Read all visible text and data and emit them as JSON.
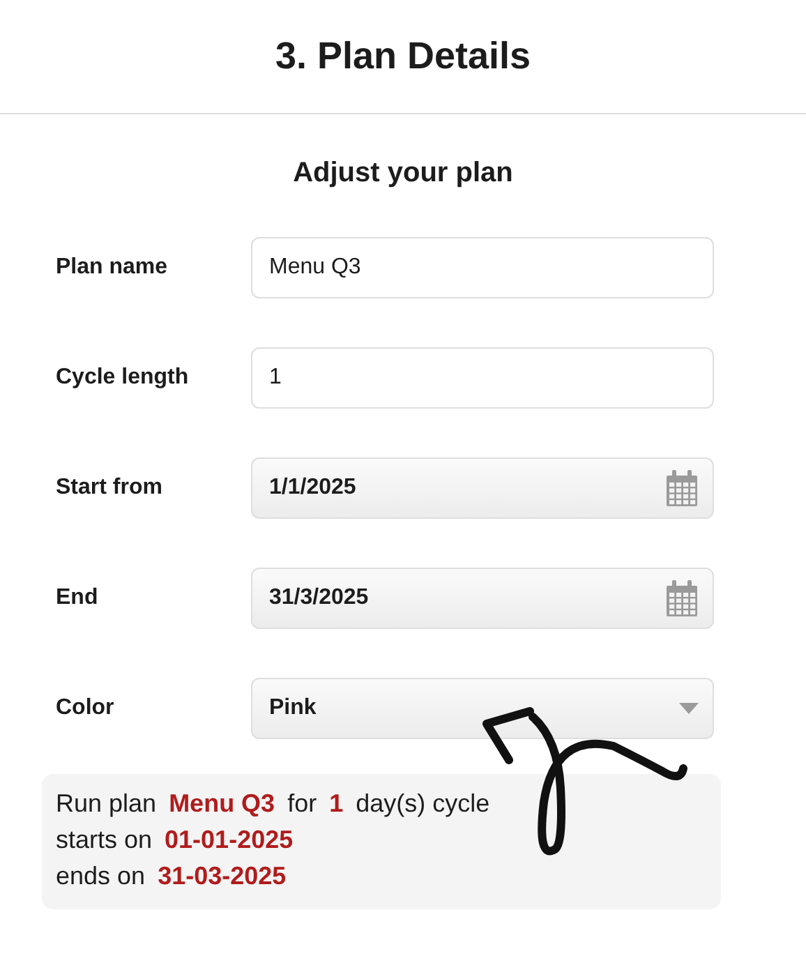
{
  "header": {
    "title": "3. Plan Details"
  },
  "form": {
    "title": "Adjust your plan",
    "fields": [
      {
        "label": "Plan name",
        "kind": "text",
        "value": "Menu Q3"
      },
      {
        "label": "Cycle length",
        "kind": "text",
        "value": "1"
      },
      {
        "label": "Start from",
        "kind": "date",
        "value": "1/1/2025"
      },
      {
        "label": "End",
        "kind": "date",
        "value": "31/3/2025"
      },
      {
        "label": "Color",
        "kind": "select",
        "value": "Pink"
      }
    ]
  },
  "summary": {
    "lines": [
      "Run plan **Menu Q3** for **1** day(s) cycle",
      "starts on **01-01-2025**",
      "ends on **31-03-2025**"
    ]
  }
}
